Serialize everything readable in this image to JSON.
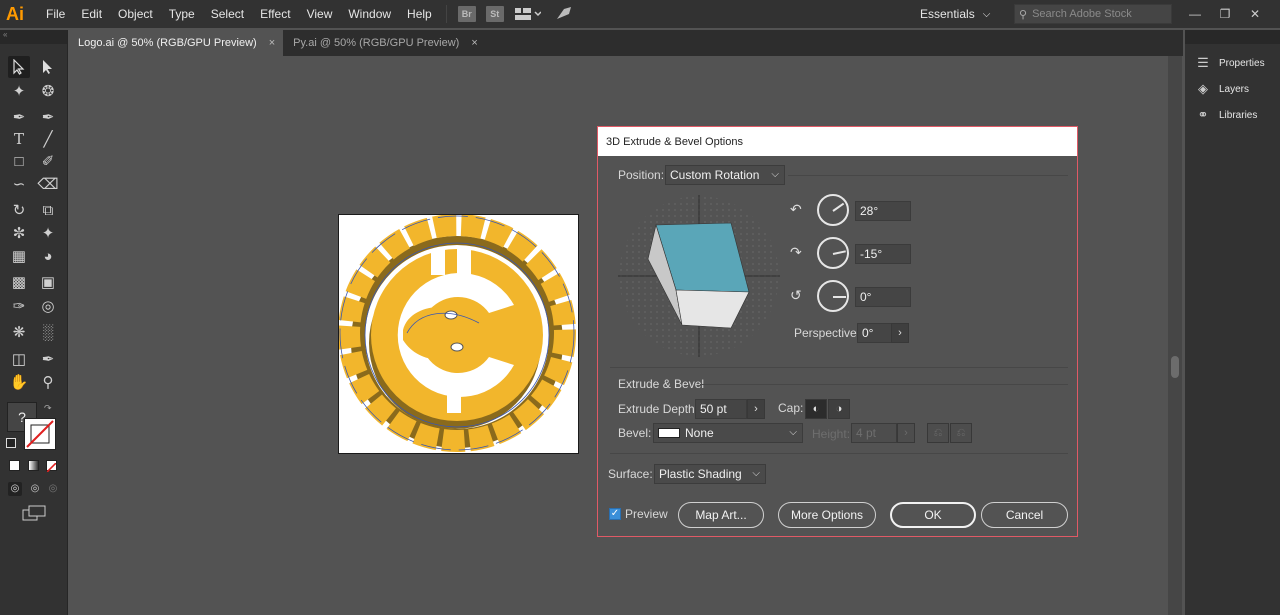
{
  "app": {
    "logo": "Ai"
  },
  "menu": [
    "File",
    "Edit",
    "Object",
    "Type",
    "Select",
    "Effect",
    "View",
    "Window",
    "Help"
  ],
  "toolbar_icons": {
    "bridge": "Br",
    "stock": "St"
  },
  "workspace": {
    "label": "Essentials"
  },
  "search": {
    "placeholder": "Search Adobe Stock"
  },
  "tabs": [
    {
      "label": "Logo.ai @ 50% (RGB/GPU Preview)",
      "close": "×"
    },
    {
      "label": "Py.ai @ 50% (RGB/GPU Preview)",
      "close": "×"
    }
  ],
  "right_panel": [
    {
      "label": "Properties",
      "icon": "properties-icon"
    },
    {
      "label": "Layers",
      "icon": "layers-icon"
    },
    {
      "label": "Libraries",
      "icon": "libraries-icon"
    }
  ],
  "dialog": {
    "title": "3D Extrude & Bevel Options",
    "position_label": "Position:",
    "position_value": "Custom Rotation",
    "rot_x": "28°",
    "rot_y": "-15°",
    "rot_z": "0°",
    "perspective_label": "Perspective:",
    "perspective_value": "0°",
    "extrude_section": "Extrude & Bevel",
    "extrude_depth_label": "Extrude Depth:",
    "extrude_depth_value": "50 pt",
    "cap_label": "Cap:",
    "bevel_label": "Bevel:",
    "bevel_value": "None",
    "height_label": "Height:",
    "height_value": "4 pt",
    "surface_label": "Surface:",
    "surface_value": "Plastic Shading",
    "preview_label": "Preview",
    "preview_checked": true,
    "buttons": {
      "map_art": "Map Art...",
      "more_options": "More Options",
      "ok": "OK",
      "cancel": "Cancel"
    }
  },
  "toolbar_misc": {
    "help_glyph": "?"
  },
  "colors": {
    "accent": "#e05a66",
    "cube_face": "#5aa6b8",
    "logo_yellow": "#f2b62c",
    "logo_shadow": "#8a6a1c",
    "ai_brand": "#ff9a00"
  }
}
